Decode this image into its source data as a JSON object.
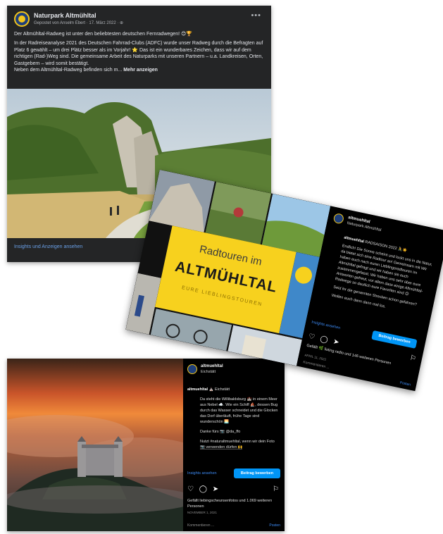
{
  "facebook_post": {
    "page_name": "Naturpark Altmühltal",
    "subline": "Gepostet von Anselm Ebert · 17. März 2022 · ⊕",
    "more_icon": "more-horizontal-icon",
    "paragraphs": [
      "Der Altmühltal-Radweg ist unter den beliebtesten deutschen Fernradwegen! 😊🏆",
      "In der Radreiseanalyse 2021 des Deutschen Fahrrad-Clubs (ADFC) wurde unser Radweg durch die Befragten auf Platz 6 gewählt – um drei Plätz besser als im Vorjahr! ⭐ Das ist ein wunderbares Zeichen, dass wir auf dem richtigen (Rad-)Weg sind. Die gemeinsame Arbeit des Naturparks mit unseren Partnern – u.a. Landkreisen, Orten, Gastgebern – wird somit bestätigt.",
      "Neben dem Altmühltal-Radweg befinden sich m..."
    ],
    "more_label": "Mehr anzeigen",
    "insights_label": "Insights und Anzeigen ansehen"
  },
  "carousel_post": {
    "username": "altmuehltal",
    "location": "Naturpark Altmühltal",
    "graphic_line1": "Radtouren im",
    "graphic_line2": "ALTMÜHLTAL",
    "graphic_line3": "EURE LIEBLINGSTOUREN",
    "caption_user": "altmuehltal",
    "caption_lines": [
      "RADSAISON 2022 🚴☀️",
      "Endlich! Die Sonne scheint und lockt uns in die Natur, da bietet sich eine Radtour an! Gemeinsam mit Wir haben euch nach euren Lieblingsradtouren im Altmühltal gefragt und wir haben sie euch zusammengefasst. Wir haben uns sehr über eure Antworten gefreut, vor allem dass einige Altmühltal-Radwege so deutlich eure Favoriten sind 😊",
      "Seid ihr die genannten Strecken schon gefahren?",
      "Wollen euch dann dann mal los."
    ],
    "insights_label": "Insights ansehen",
    "boost_label": "Beitrag bewerben",
    "likes_text": "Gefällt 🌿 listing.radio und 146 weiteren Personen",
    "date": "APRIL 11, 2022",
    "comment_placeholder": "Kommentieren ...",
    "post_label": "Posten"
  },
  "castle_post": {
    "username": "altmuehltal",
    "location": "Eichstätt",
    "caption_user": "altmuehltal",
    "caption_title": "⛪ Eichstätt",
    "caption_lines": [
      "Da steht die Willibaldsburg 🏰 in einem Meer aus Nebel ☁️. Wie ein Schiff ⛵, dessen Bug durch das Wasser schneidet und die Glocken das Dorf überläuft, frühe Tage sind wunderschön 🌅",
      "Danke fürs 📷 @da_ffo",
      "Nutzt #naturaltmuehltal, wenn wir dein Foto 📷 verwenden dürfen 🙌"
    ],
    "insights_label": "Insights ansehen",
    "boost_label": "Beitrag bewerben",
    "likes_text": "Gefällt liebingscheunsenfotos und 1.069 weiteren Personen",
    "date": "NOVEMBER 1, 2021",
    "comment_placeholder": "Kommentieren ...",
    "post_label": "Posten"
  },
  "colors": {
    "facebook_bg": "#242526",
    "instagram_bg": "#000000",
    "accent_blue": "#0095f6",
    "brand_yellow": "#f7d11e"
  }
}
